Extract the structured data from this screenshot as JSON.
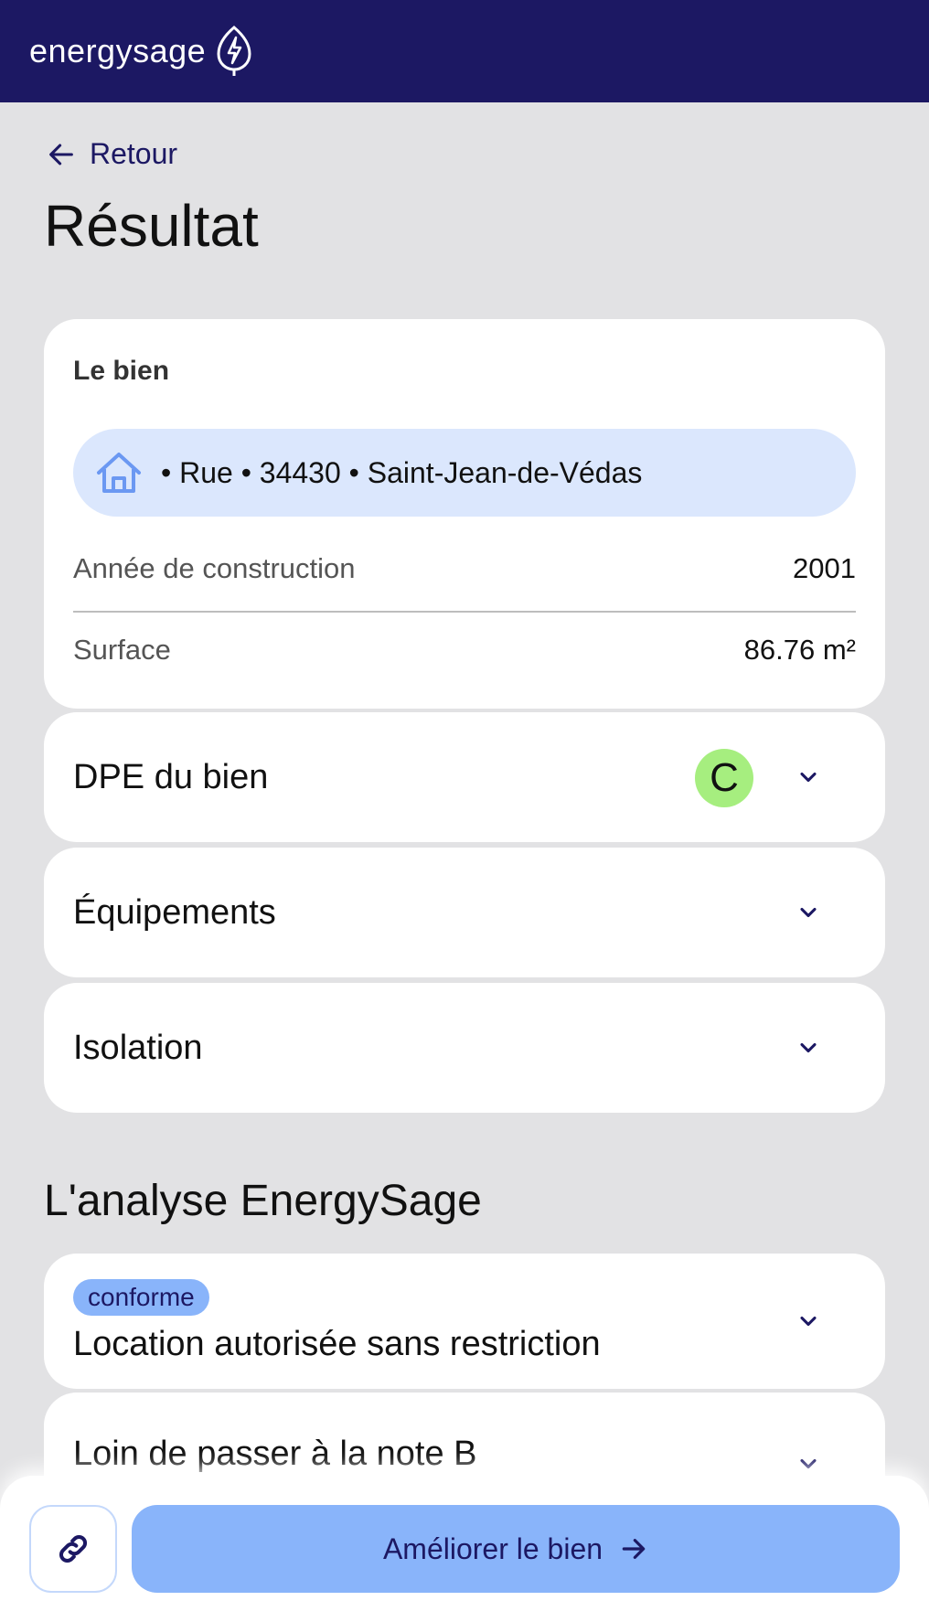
{
  "header": {
    "brand": "energysage",
    "logo_icon": "leaf-bolt-icon"
  },
  "nav": {
    "back_label": "Retour"
  },
  "page": {
    "title": "Résultat"
  },
  "property": {
    "section_label": "Le bien",
    "address": "• Rue • 34430 • Saint-Jean-de-Védas",
    "fields": [
      {
        "label": "Année de construction",
        "value": "2001"
      },
      {
        "label": "Surface",
        "value": "86.76 m²"
      }
    ]
  },
  "accordions": [
    {
      "label": "DPE du bien",
      "grade": "C",
      "grade_color": "#a6ee7f"
    },
    {
      "label": "Équipements"
    },
    {
      "label": "Isolation"
    }
  ],
  "analysis": {
    "title": "L'analyse EnergySage",
    "items": [
      {
        "badge": "conforme",
        "label": "Location autorisée sans restriction"
      },
      {
        "label": "Loin de passer à la note B"
      }
    ]
  },
  "footer": {
    "cta_label": "Améliorer le bien"
  },
  "colors": {
    "brand": "#1c1863",
    "accent": "#89b4fa",
    "address_bg": "#dbe7fd"
  }
}
